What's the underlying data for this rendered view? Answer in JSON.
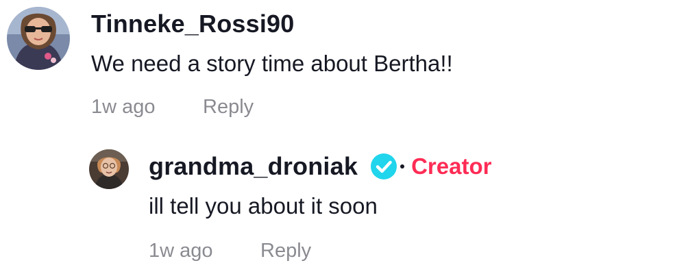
{
  "comments": [
    {
      "username": "Tinneke_Rossi90",
      "text": "We need a story time about Bertha!!",
      "time": "1w ago",
      "reply_label": "Reply"
    }
  ],
  "reply": {
    "username": "grandma_droniak",
    "verified_icon": "verified-check-icon",
    "badge": "Creator",
    "text": "ill tell you about it soon",
    "time": "1w ago",
    "reply_label": "Reply"
  },
  "colors": {
    "text_primary": "#161823",
    "text_secondary": "#8a8b91",
    "creator_badge": "#fe2c55",
    "verified": "#20d5ec"
  }
}
